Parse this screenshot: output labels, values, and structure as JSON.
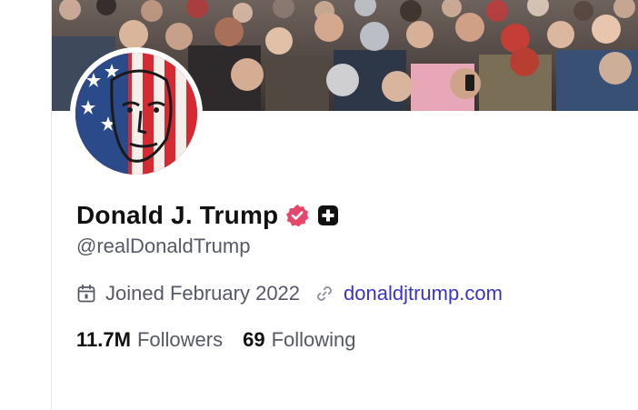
{
  "profile": {
    "display_name": "Donald J. Trump",
    "handle": "@realDonaldTrump",
    "joined": "Joined February 2022",
    "website": "donaldjtrump.com",
    "followers_count": "11.7M",
    "followers_label": "Followers",
    "following_count": "69",
    "following_label": "Following"
  },
  "icons": {
    "verified": "verified-badge-icon",
    "plus_badge": "plus-badge-icon",
    "calendar": "calendar-icon",
    "link": "link-icon"
  },
  "colors": {
    "name": "#111111",
    "secondary_text": "#555a66",
    "link": "#3b33c8",
    "verified_badge": "#e5476a",
    "plus_badge": "#111111"
  }
}
